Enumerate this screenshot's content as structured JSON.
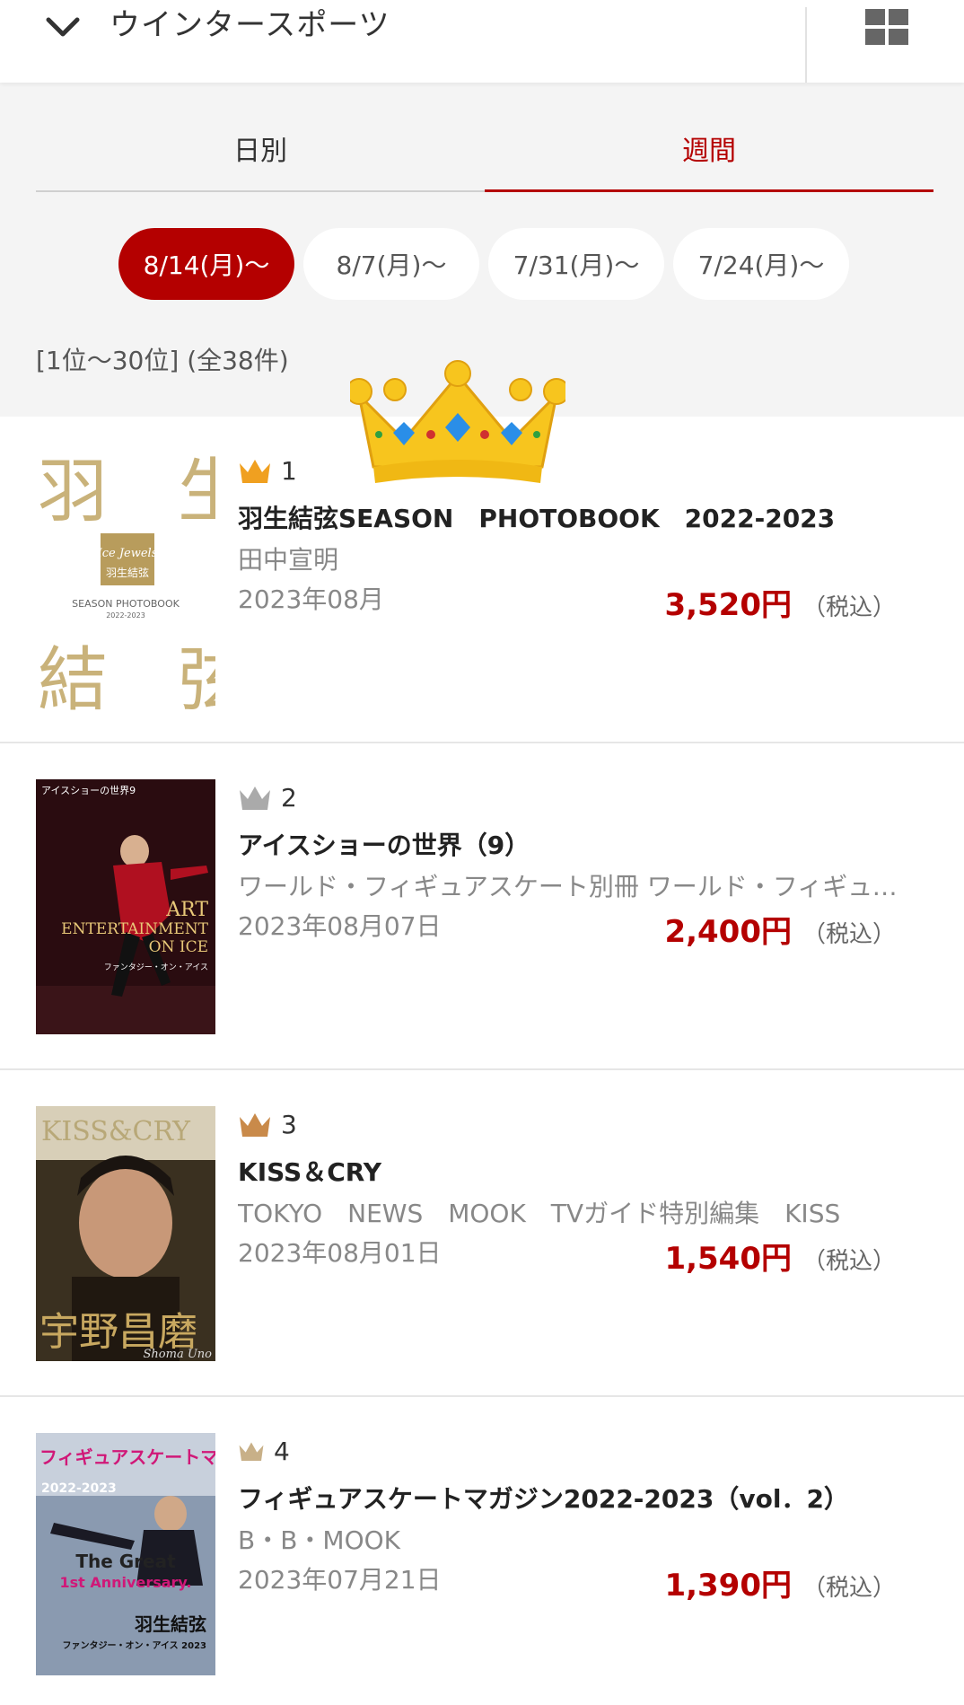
{
  "header": {
    "title": "ウインタースポーツ",
    "back_icon": "chevron-down-icon",
    "view_icon": "grid-view-icon"
  },
  "tabs": [
    {
      "label": "日別",
      "active": false
    },
    {
      "label": "週間",
      "active": true
    }
  ],
  "weeks": [
    {
      "label": "8/14(月)〜",
      "active": true
    },
    {
      "label": "8/7(月)〜",
      "active": false
    },
    {
      "label": "7/31(月)〜",
      "active": false
    },
    {
      "label": "7/24(月)〜",
      "active": false
    }
  ],
  "range_text": "[1位〜30位] (全38件)",
  "colors": {
    "accent": "#b40000",
    "gold": "#f0a020",
    "silver": "#aaaaaa",
    "bronze": "#c98a4a"
  },
  "items": [
    {
      "rank": "1",
      "title": "羽生結弦SEASON　PHOTOBOOK　2022-2023",
      "author": "田中宣明",
      "date": "2023年08月",
      "price": "3,520円",
      "tax": "（税込）",
      "cover": {
        "line1": "羽　生",
        "line2": "結　弦",
        "badge": "Ice Jewels",
        "name": "羽生結弦",
        "subtitle": "SEASON PHOTOBOOK",
        "years": "2022-2023"
      }
    },
    {
      "rank": "2",
      "title": "アイスショーの世界（9）",
      "author": "ワールド・フィギュアスケート別冊 ワールド・フィギュアスケート別冊",
      "date": "2023年08月07日",
      "price": "2,400円",
      "tax": "（税込）",
      "cover": {
        "top": "アイスショーの世界9",
        "line1": "ART",
        "line2": "ENTERTAINMENT",
        "line3": "ON ICE",
        "sub": "ファンタジー・オン・アイス"
      }
    },
    {
      "rank": "3",
      "title": "KISS＆CRY",
      "author": "TOKYO　NEWS　MOOK　TVガイド特別編集　KISS",
      "date": "2023年08月01日",
      "price": "1,540円",
      "tax": "（税込）",
      "cover": {
        "top": "KISS&CRY",
        "name": "宇野昌磨",
        "sign": "Shoma Uno"
      }
    },
    {
      "rank": "4",
      "title": "フィギュアスケートマガジン2022-2023（vol．2）",
      "author": "B・B・MOOK",
      "date": "2023年07月21日",
      "price": "1,390円",
      "tax": "（税込）",
      "cover": {
        "top": "フィギュアスケートマガジン",
        "year": "2022-2023",
        "line1": "The Great",
        "line2": "1st Anniversary.",
        "name": "羽生結弦",
        "sub": "ファンタジー・オン・アイス 2023"
      }
    }
  ]
}
